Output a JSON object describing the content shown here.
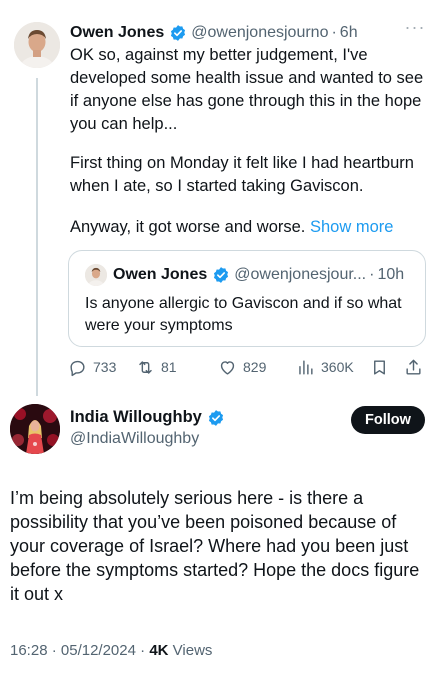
{
  "parent_tweet": {
    "author_name": "Owen Jones",
    "handle": "@owenjonesjourno",
    "separator": "·",
    "age": "6h",
    "more_icon": "more-dots-icon",
    "paragraphs": [
      "OK so, against my better judgement, I've developed some health issue and wanted to see if anyone else has gone through this in the hope you can help...",
      "First thing on Monday it felt like I had heartburn when I ate, so I started taking Gaviscon.",
      "Anyway, it got worse and worse."
    ],
    "show_more_label": "Show more",
    "quoted": {
      "author_name": "Owen Jones",
      "handle": "@owenjonesjour...",
      "separator": "·",
      "age": "10h",
      "text": "Is anyone allergic to Gaviscon and if so what were your symptoms"
    },
    "actions": {
      "replies": "733",
      "reposts": "81",
      "likes": "829",
      "views": "360K"
    }
  },
  "reply_tweet": {
    "author_name": "India Willoughby",
    "handle": "@IndiaWilloughby",
    "follow_label": "Follow",
    "text": "I’m being absolutely serious here - is there a possibility that you’ve been poisoned because of your coverage of Israel? Where had you been just before the symptoms started? Hope the docs figure it out x",
    "time": "16:28",
    "date": "05/12/2024",
    "separator": "·",
    "views_count": "4K",
    "views_label": "Views"
  },
  "colors": {
    "text": "#0f1419",
    "muted": "#536471",
    "link": "#1d9bf0",
    "verified": "#1d9bf0",
    "border": "#cfd9de",
    "follow_bg": "#0f1419"
  }
}
